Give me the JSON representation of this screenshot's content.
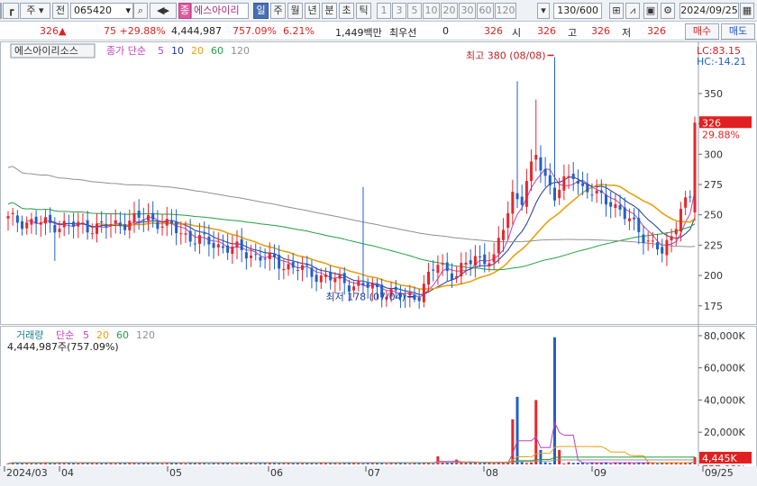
{
  "toolbar": {
    "type_label": "주",
    "prev_label": "전",
    "code": "065420",
    "badge": "종",
    "name": "에스아이리",
    "periods": [
      "일",
      "주",
      "월",
      "년",
      "분",
      "초",
      "틱"
    ],
    "numbers": [
      "1",
      "3",
      "5",
      "10",
      "20",
      "30",
      "60",
      "120"
    ],
    "count": "130/600",
    "date": "2024/09/25"
  },
  "quote": {
    "price": "326",
    "arrow": "▲",
    "change": "75 +29.88%",
    "volume": "4,444,987",
    "vol_ratio": "757.09%",
    "turnover": "6.21%",
    "amount": "1,449백만",
    "priority_label": "최우선",
    "priority_value": "0",
    "current": "326",
    "open_label": "시",
    "open": "326",
    "high_label": "고",
    "high": "326",
    "low_label": "저",
    "low": "326",
    "buy_label": "매수",
    "sell_label": "매도"
  },
  "price_panel": {
    "title_box": "에스아이리소스",
    "ma_label": "종가 단순",
    "ma_periods": [
      "5",
      "10",
      "20",
      "60",
      "120"
    ],
    "lc": "LC:83.15",
    "hc": "HC:-14.21",
    "max_label": "최고 380 (08/08)",
    "min_label": "최저 178 (07/04)",
    "last_price_box": "326",
    "last_pct": "29.88%",
    "y_ticks": [
      "350",
      "325",
      "300",
      "275",
      "250",
      "225",
      "200",
      "175"
    ]
  },
  "volume_panel": {
    "title": "거래량",
    "ma_label": "단순",
    "ma_periods": [
      "5",
      "20",
      "60",
      "120"
    ],
    "value_label": "4,444,987주(757.09%)",
    "y_ticks": [
      "80,000K",
      "60,000K",
      "40,000K",
      "20,000K"
    ],
    "last_box": "4,445K",
    "last_pct": "757.09%"
  },
  "x_axis": [
    "2024/03",
    "04",
    "05",
    "06",
    "07",
    "08",
    "09",
    "09/25"
  ],
  "colors": {
    "up": "#e8262b",
    "down": "#2060c8",
    "ma5": "#c040c0",
    "ma10": "#1a3a9a",
    "ma20": "#e8a010",
    "ma60": "#20a040",
    "ma120": "#909090"
  },
  "chart_data": {
    "type": "candlestick",
    "ohlc_anchor_closes": [
      [
        0,
        246
      ],
      [
        10,
        242
      ],
      [
        20,
        240
      ],
      [
        30,
        248
      ],
      [
        40,
        230
      ],
      [
        50,
        220
      ],
      [
        60,
        208
      ],
      [
        70,
        196
      ],
      [
        80,
        188
      ],
      [
        85,
        182
      ],
      [
        88,
        185
      ],
      [
        92,
        210
      ],
      [
        96,
        200
      ],
      [
        100,
        216
      ],
      [
        104,
        212
      ],
      [
        108,
        268
      ],
      [
        110,
        262
      ],
      [
        113,
        300
      ],
      [
        117,
        265
      ],
      [
        119,
        275
      ],
      [
        121,
        285
      ],
      [
        123,
        272
      ],
      [
        126,
        265
      ],
      [
        129,
        262
      ],
      [
        132,
        248
      ],
      [
        135,
        238
      ],
      [
        138,
        225
      ],
      [
        140,
        218
      ],
      [
        142,
        232
      ],
      [
        144,
        258
      ],
      [
        146,
        262
      ],
      [
        147,
        326
      ]
    ],
    "volume_spikes_k": {
      "92": 5000,
      "96": 3000,
      "108": 28000,
      "109": 42000,
      "113": 40000,
      "114": 9000,
      "117": 79000,
      "118": 9000
    },
    "max": {
      "value": 380,
      "date": "08/08"
    },
    "min": {
      "value": 178,
      "date": "07/04"
    },
    "y_price_range": [
      160,
      390
    ],
    "y_volume_range": [
      0,
      85000
    ]
  }
}
